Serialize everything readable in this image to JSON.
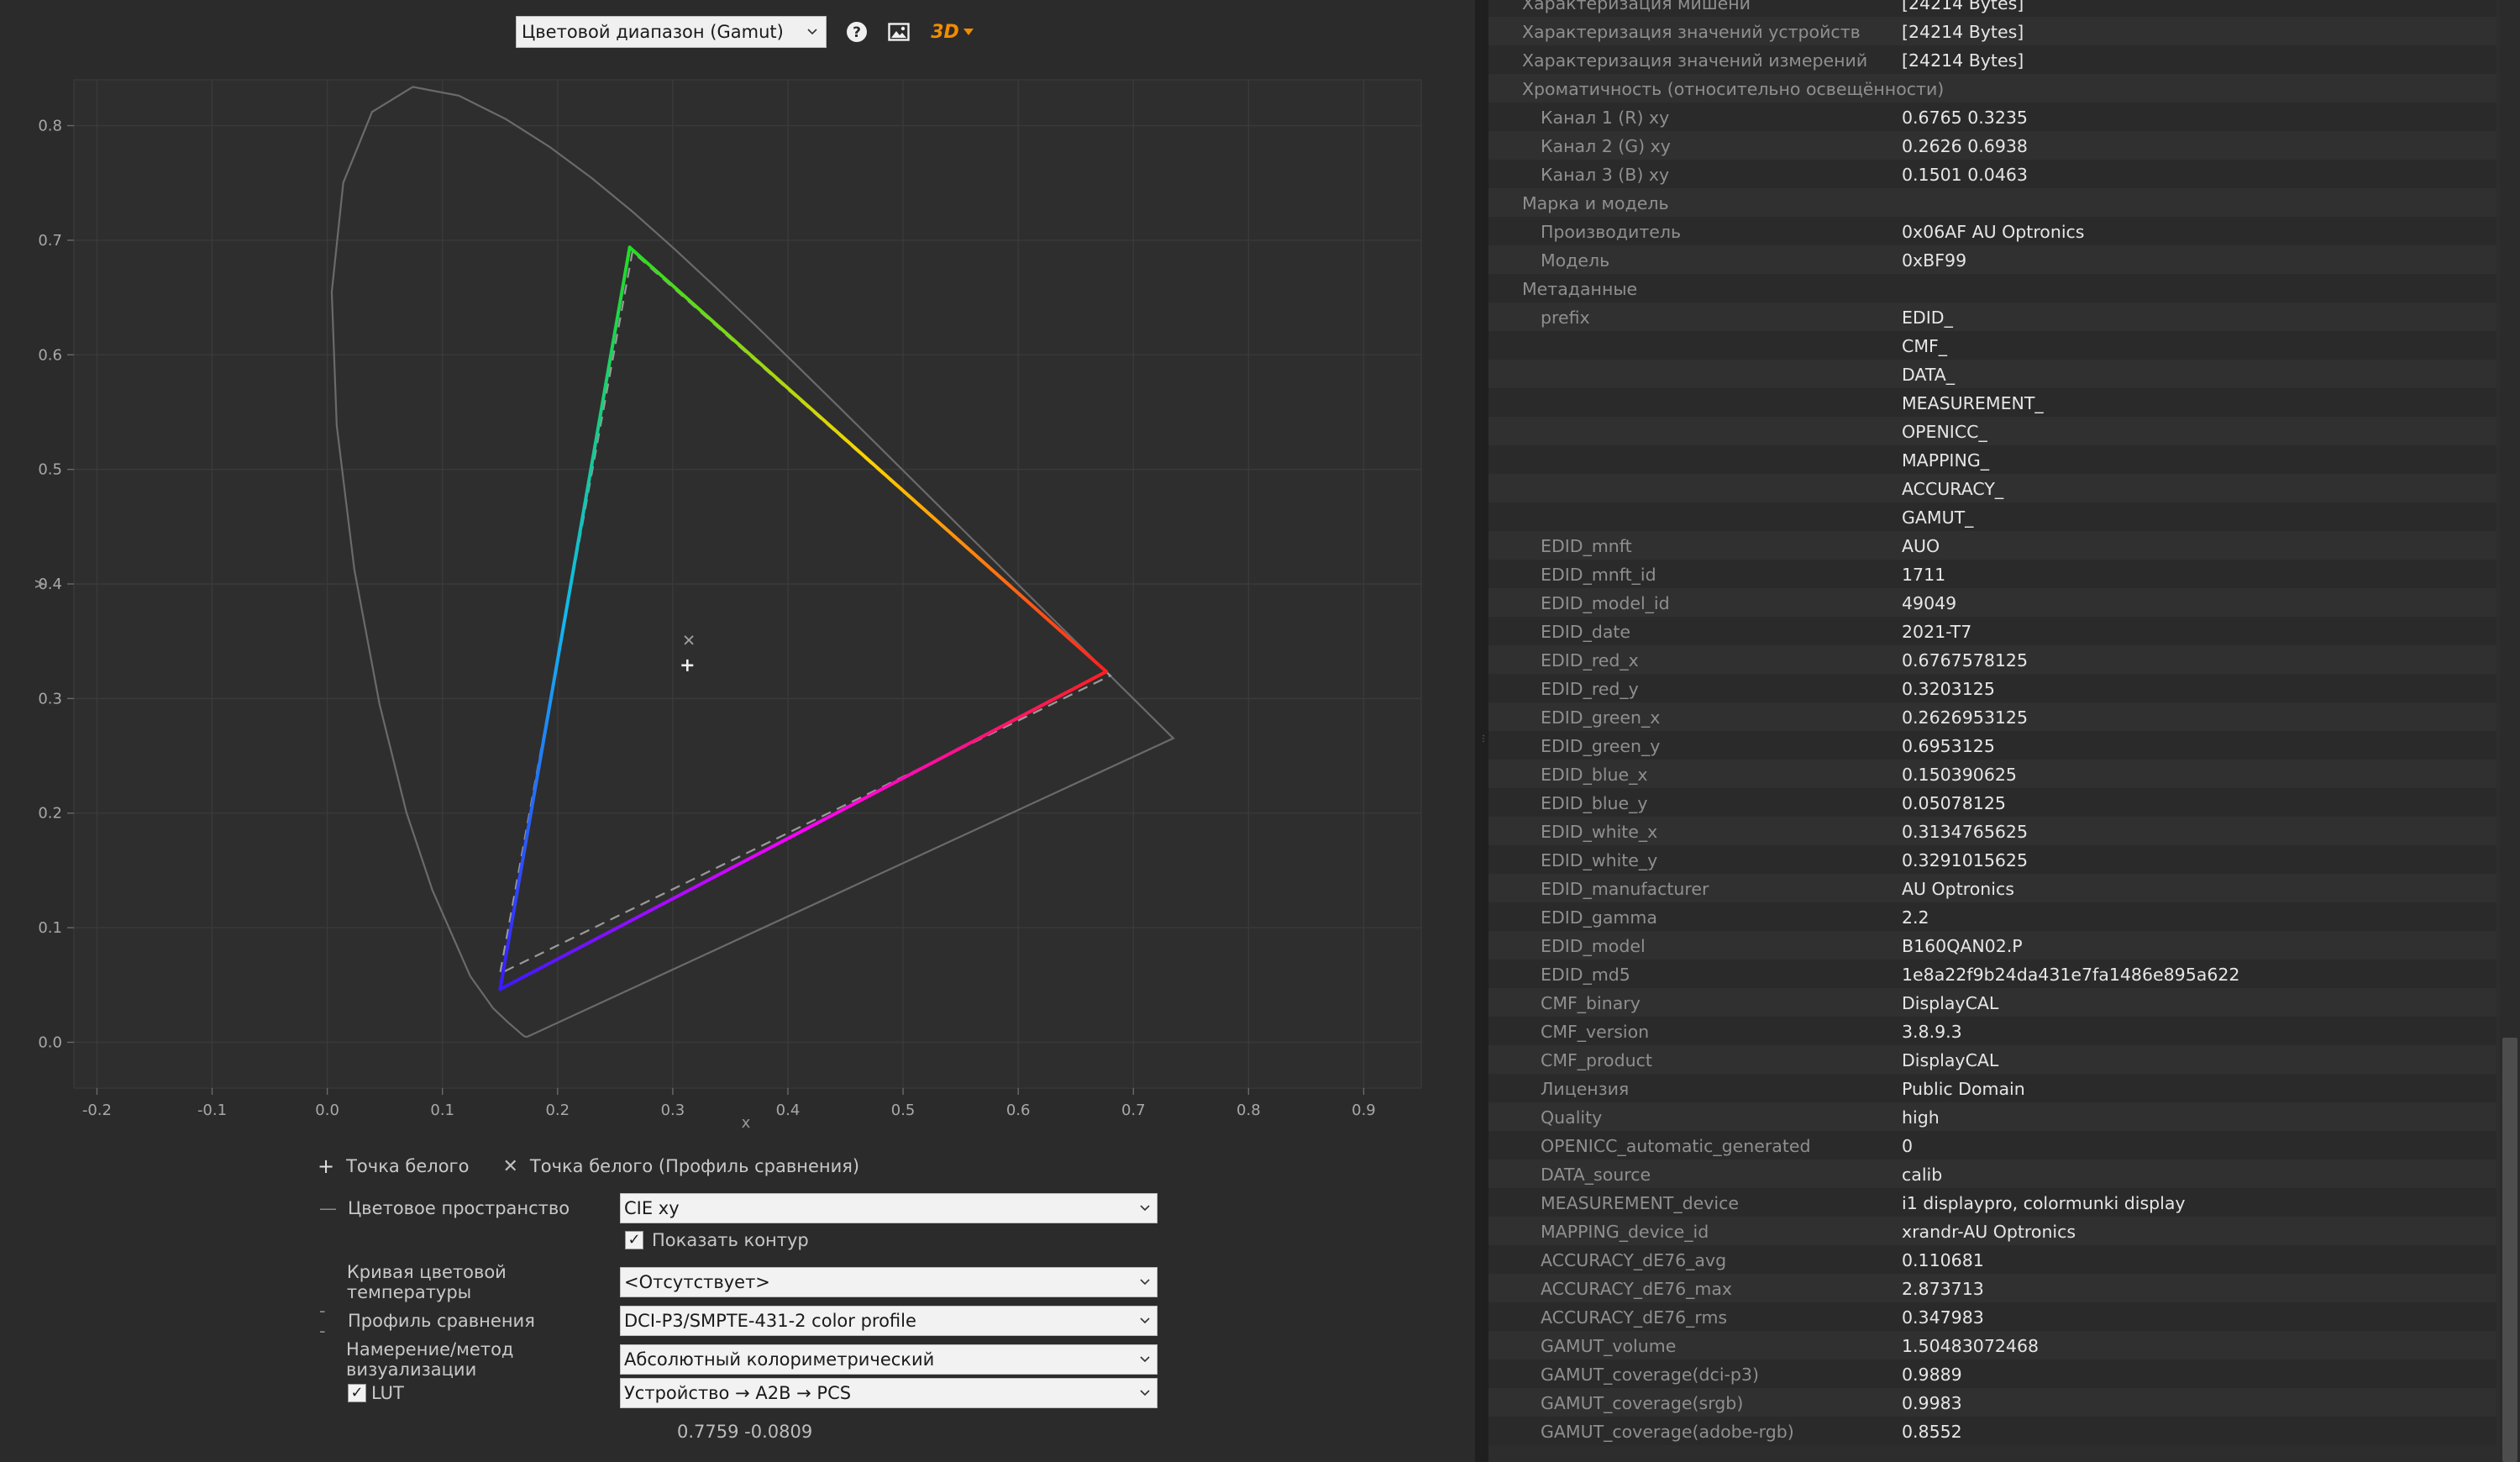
{
  "toolbar": {
    "view_select": "Цветовой диапазон (Gamut)",
    "help_icon": "help-icon",
    "save_image_icon": "image-icon",
    "view_3d_label": "3D",
    "accent": "#f28c00"
  },
  "chart_data": {
    "type": "line",
    "xlabel": "x",
    "ylabel": "y",
    "xlim": [
      -0.22,
      0.95
    ],
    "ylim": [
      -0.04,
      0.84
    ],
    "xticks": [
      -0.2,
      -0.1,
      0.0,
      0.1,
      0.2,
      0.3,
      0.4,
      0.5,
      0.6,
      0.7,
      0.8,
      0.9
    ],
    "yticks": [
      0.0,
      0.1,
      0.2,
      0.3,
      0.4,
      0.5,
      0.6,
      0.7,
      0.8
    ],
    "xtick_labels": [
      "-0.2",
      "-0.1",
      "0.0",
      "0.1",
      "0.2",
      "0.3",
      "0.4",
      "0.5",
      "0.6",
      "0.7",
      "0.8",
      "0.9"
    ],
    "ytick_labels": [
      "0.0",
      "0.1",
      "0.2",
      "0.3",
      "0.4",
      "0.5",
      "0.6",
      "0.7",
      "0.8"
    ],
    "grid": true,
    "series": [
      {
        "role": "spectral-locus",
        "color": "#6a6a6a",
        "points": [
          [
            0.1741,
            0.005
          ],
          [
            0.1738,
            0.0049
          ],
          [
            0.1733,
            0.0048
          ],
          [
            0.1726,
            0.0048
          ],
          [
            0.1714,
            0.0051
          ],
          [
            0.1689,
            0.0069
          ],
          [
            0.1644,
            0.0109
          ],
          [
            0.1566,
            0.0177
          ],
          [
            0.144,
            0.0297
          ],
          [
            0.1241,
            0.0578
          ],
          [
            0.0913,
            0.1327
          ],
          [
            0.0687,
            0.2007
          ],
          [
            0.0454,
            0.295
          ],
          [
            0.0235,
            0.4127
          ],
          [
            0.0082,
            0.5384
          ],
          [
            0.0039,
            0.6548
          ],
          [
            0.0139,
            0.7502
          ],
          [
            0.0389,
            0.812
          ],
          [
            0.0743,
            0.8338
          ],
          [
            0.1142,
            0.8262
          ],
          [
            0.1547,
            0.8059
          ],
          [
            0.1929,
            0.7816
          ],
          [
            0.2296,
            0.7543
          ],
          [
            0.2658,
            0.7243
          ],
          [
            0.3016,
            0.6923
          ],
          [
            0.3373,
            0.6589
          ],
          [
            0.3731,
            0.6245
          ],
          [
            0.4087,
            0.5896
          ],
          [
            0.4441,
            0.5547
          ],
          [
            0.4788,
            0.5202
          ],
          [
            0.5125,
            0.4866
          ],
          [
            0.5448,
            0.4544
          ],
          [
            0.5752,
            0.4242
          ],
          [
            0.6029,
            0.3965
          ],
          [
            0.627,
            0.3725
          ],
          [
            0.6482,
            0.3514
          ],
          [
            0.6658,
            0.334
          ],
          [
            0.6801,
            0.3197
          ],
          [
            0.6915,
            0.3083
          ],
          [
            0.7006,
            0.2993
          ],
          [
            0.714,
            0.2859
          ],
          [
            0.7347,
            0.2653
          ],
          [
            0.1741,
            0.005
          ]
        ]
      },
      {
        "role": "profile-gamut",
        "colors": {
          "red": "#ff2020",
          "green": "#22dd22",
          "blue": "#3a1aff"
        },
        "red": [
          0.6765,
          0.3235
        ],
        "green": [
          0.2626,
          0.6938
        ],
        "blue": [
          0.1501,
          0.0463
        ]
      },
      {
        "role": "comparison-gamut-dci-p3",
        "style": "dashed",
        "color": "#9a9a9a",
        "red": [
          0.68,
          0.32
        ],
        "green": [
          0.265,
          0.69
        ],
        "blue": [
          0.15,
          0.06
        ]
      }
    ],
    "whitepoint": [
      0.3127,
      0.329
    ],
    "whitepoint_reference": [
      0.314,
      0.351
    ]
  },
  "legend": {
    "white_point": "Точка белого",
    "white_point_compare": "Точка белого (Профиль сравнения)"
  },
  "controls": {
    "colorspace_label": "Цветовое пространство",
    "colorspace_value": "CIE xy",
    "show_outline_label": "Показать контур",
    "cct_curve_label": "Кривая цветовой температуры",
    "cct_curve_value": "<Отсутствует>",
    "compare_profile_label": "Профиль сравнения",
    "compare_profile_value": "DCI-P3/SMPTE-431-2 color profile",
    "intent_label": "Намерение/метод визуализации",
    "intent_value": "Абсолютный колориметрический",
    "lut_label": "LUT",
    "lut_value": "Устройство → A2B → PCS",
    "coordinates": "0.7759 -0.0809"
  },
  "info_rows": [
    {
      "key": "Характеризация мишени",
      "value": "[24214 Bytes]",
      "level": 0
    },
    {
      "key": "Характеризация значений устройств",
      "value": "[24214 Bytes]",
      "level": 0
    },
    {
      "key": "Характеризация значений измерений",
      "value": "[24214 Bytes]",
      "level": 0
    },
    {
      "key": "Хроматичность (относительно освещённости)",
      "value": "",
      "level": 0
    },
    {
      "key": "Канал 1 (R) xy",
      "value": "0.6765 0.3235",
      "level": 1
    },
    {
      "key": "Канал 2 (G) xy",
      "value": "0.2626 0.6938",
      "level": 1
    },
    {
      "key": "Канал 3 (B) xy",
      "value": "0.1501 0.0463",
      "level": 1
    },
    {
      "key": "Марка и модель",
      "value": "",
      "level": 0
    },
    {
      "key": "Производитель",
      "value": "0x06AF AU Optronics",
      "level": 1
    },
    {
      "key": "Модель",
      "value": "0xBF99",
      "level": 1
    },
    {
      "key": "Метаданные",
      "value": "",
      "level": 0
    },
    {
      "key": "prefix",
      "value": "EDID_",
      "level": 1
    },
    {
      "key": "",
      "value": "CMF_",
      "level": 1
    },
    {
      "key": "",
      "value": "DATA_",
      "level": 1
    },
    {
      "key": "",
      "value": "MEASUREMENT_",
      "level": 1
    },
    {
      "key": "",
      "value": "OPENICC_",
      "level": 1
    },
    {
      "key": "",
      "value": "MAPPING_",
      "level": 1
    },
    {
      "key": "",
      "value": "ACCURACY_",
      "level": 1
    },
    {
      "key": "",
      "value": "GAMUT_",
      "level": 1
    },
    {
      "key": "EDID_mnft",
      "value": "AUO",
      "level": 1
    },
    {
      "key": "EDID_mnft_id",
      "value": "1711",
      "level": 1
    },
    {
      "key": "EDID_model_id",
      "value": "49049",
      "level": 1
    },
    {
      "key": "EDID_date",
      "value": "2021-T7",
      "level": 1
    },
    {
      "key": "EDID_red_x",
      "value": "0.6767578125",
      "level": 1
    },
    {
      "key": "EDID_red_y",
      "value": "0.3203125",
      "level": 1
    },
    {
      "key": "EDID_green_x",
      "value": "0.2626953125",
      "level": 1
    },
    {
      "key": "EDID_green_y",
      "value": "0.6953125",
      "level": 1
    },
    {
      "key": "EDID_blue_x",
      "value": "0.150390625",
      "level": 1
    },
    {
      "key": "EDID_blue_y",
      "value": "0.05078125",
      "level": 1
    },
    {
      "key": "EDID_white_x",
      "value": "0.3134765625",
      "level": 1
    },
    {
      "key": "EDID_white_y",
      "value": "0.3291015625",
      "level": 1
    },
    {
      "key": "EDID_manufacturer",
      "value": "AU Optronics",
      "level": 1
    },
    {
      "key": "EDID_gamma",
      "value": "2.2",
      "level": 1
    },
    {
      "key": "EDID_model",
      "value": "B160QAN02.P",
      "level": 1
    },
    {
      "key": "EDID_md5",
      "value": "1e8a22f9b24da431e7fa1486e895a622",
      "level": 1
    },
    {
      "key": "CMF_binary",
      "value": "DisplayCAL",
      "level": 1
    },
    {
      "key": "CMF_version",
      "value": "3.8.9.3",
      "level": 1
    },
    {
      "key": "CMF_product",
      "value": "DisplayCAL",
      "level": 1
    },
    {
      "key": "Лицензия",
      "value": "Public Domain",
      "level": 1
    },
    {
      "key": "Quality",
      "value": "high",
      "level": 1
    },
    {
      "key": "OPENICC_automatic_generated",
      "value": "0",
      "level": 1
    },
    {
      "key": "DATA_source",
      "value": "calib",
      "level": 1
    },
    {
      "key": "MEASUREMENT_device",
      "value": "i1 displaypro, colormunki display",
      "level": 1
    },
    {
      "key": "MAPPING_device_id",
      "value": "xrandr-AU Optronics",
      "level": 1
    },
    {
      "key": "ACCURACY_dE76_avg",
      "value": "0.110681",
      "level": 1
    },
    {
      "key": "ACCURACY_dE76_max",
      "value": "2.873713",
      "level": 1
    },
    {
      "key": "ACCURACY_dE76_rms",
      "value": "0.347983",
      "level": 1
    },
    {
      "key": "GAMUT_volume",
      "value": "1.50483072468",
      "level": 1
    },
    {
      "key": "GAMUT_coverage(dci-p3)",
      "value": "0.9889",
      "level": 1
    },
    {
      "key": "GAMUT_coverage(srgb)",
      "value": "0.9983",
      "level": 1
    },
    {
      "key": "GAMUT_coverage(adobe-rgb)",
      "value": "0.8552",
      "level": 1
    }
  ],
  "scrollbar": {
    "position": 0.71,
    "visible_fraction": 0.29
  }
}
